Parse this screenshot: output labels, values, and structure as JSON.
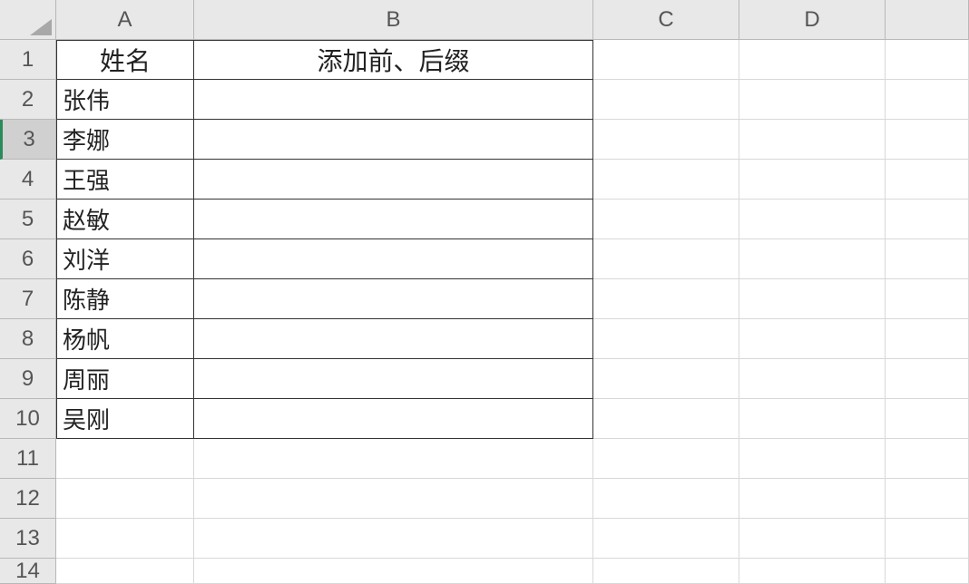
{
  "columns": [
    "A",
    "B",
    "C",
    "D",
    ""
  ],
  "rows": [
    "1",
    "2",
    "3",
    "4",
    "5",
    "6",
    "7",
    "8",
    "9",
    "10",
    "11",
    "12",
    "13",
    "14"
  ],
  "selectedRow": 3,
  "headers": {
    "A": "姓名",
    "B": "添加前、后缀"
  },
  "data": {
    "A2": "张伟",
    "A3": "李娜",
    "A4": "王强",
    "A5": "赵敏",
    "A6": "刘洋",
    "A7": "陈静",
    "A8": "杨帆",
    "A9": "周丽",
    "A10": "吴刚"
  },
  "dataRange": {
    "startRow": 1,
    "endRow": 10,
    "startCol": "A",
    "endCol": "B"
  },
  "chart_data": {
    "type": "table",
    "title": "",
    "columns": [
      "姓名",
      "添加前、后缀"
    ],
    "rows": [
      [
        "张伟",
        ""
      ],
      [
        "李娜",
        ""
      ],
      [
        "王强",
        ""
      ],
      [
        "赵敏",
        ""
      ],
      [
        "刘洋",
        ""
      ],
      [
        "陈静",
        ""
      ],
      [
        "杨帆",
        ""
      ],
      [
        "周丽",
        ""
      ],
      [
        "吴刚",
        ""
      ]
    ]
  }
}
